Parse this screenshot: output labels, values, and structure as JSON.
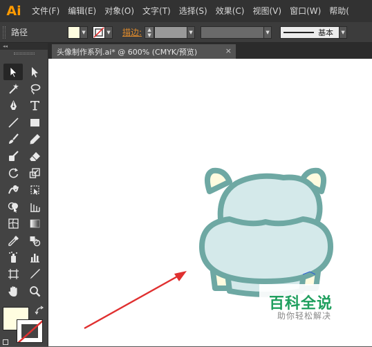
{
  "app": {
    "logo": "Ai"
  },
  "menu": [
    "文件(F)",
    "编辑(E)",
    "对象(O)",
    "文字(T)",
    "选择(S)",
    "效果(C)",
    "视图(V)",
    "窗口(W)",
    "帮助("
  ],
  "control": {
    "selection_label": "路径",
    "fill_color": "#fffde0",
    "stroke_label": "描边:",
    "brush_label": "基本"
  },
  "toolbox": {
    "collapse_glyph": "◂◂",
    "tools": [
      "selection-tool",
      "direct-selection-tool",
      "magic-wand-tool",
      "lasso-tool",
      "pen-tool",
      "type-tool",
      "line-tool",
      "rectangle-tool",
      "paintbrush-tool",
      "pencil-tool",
      "blob-brush-tool",
      "eraser-tool",
      "rotate-tool",
      "scale-tool",
      "warp-tool",
      "free-transform-tool",
      "shape-builder-tool",
      "perspective-grid-tool",
      "mesh-tool",
      "gradient-tool",
      "eyedropper-tool",
      "blend-tool",
      "symbol-sprayer-tool",
      "column-graph-tool",
      "artboard-tool",
      "slice-tool",
      "hand-tool",
      "zoom-tool"
    ]
  },
  "document": {
    "tab_title": "头像制作系列.ai* @ 600% (CMYK/预览)",
    "close_glyph": "×"
  },
  "artwork": {
    "body_fill": "#d4e9ea",
    "outline": "#6ea8a3",
    "ear_fill": "#fffbdf",
    "arrow_color": "#e03030"
  },
  "watermark": {
    "title": "百科全说",
    "subtitle": "助你轻松解决"
  }
}
